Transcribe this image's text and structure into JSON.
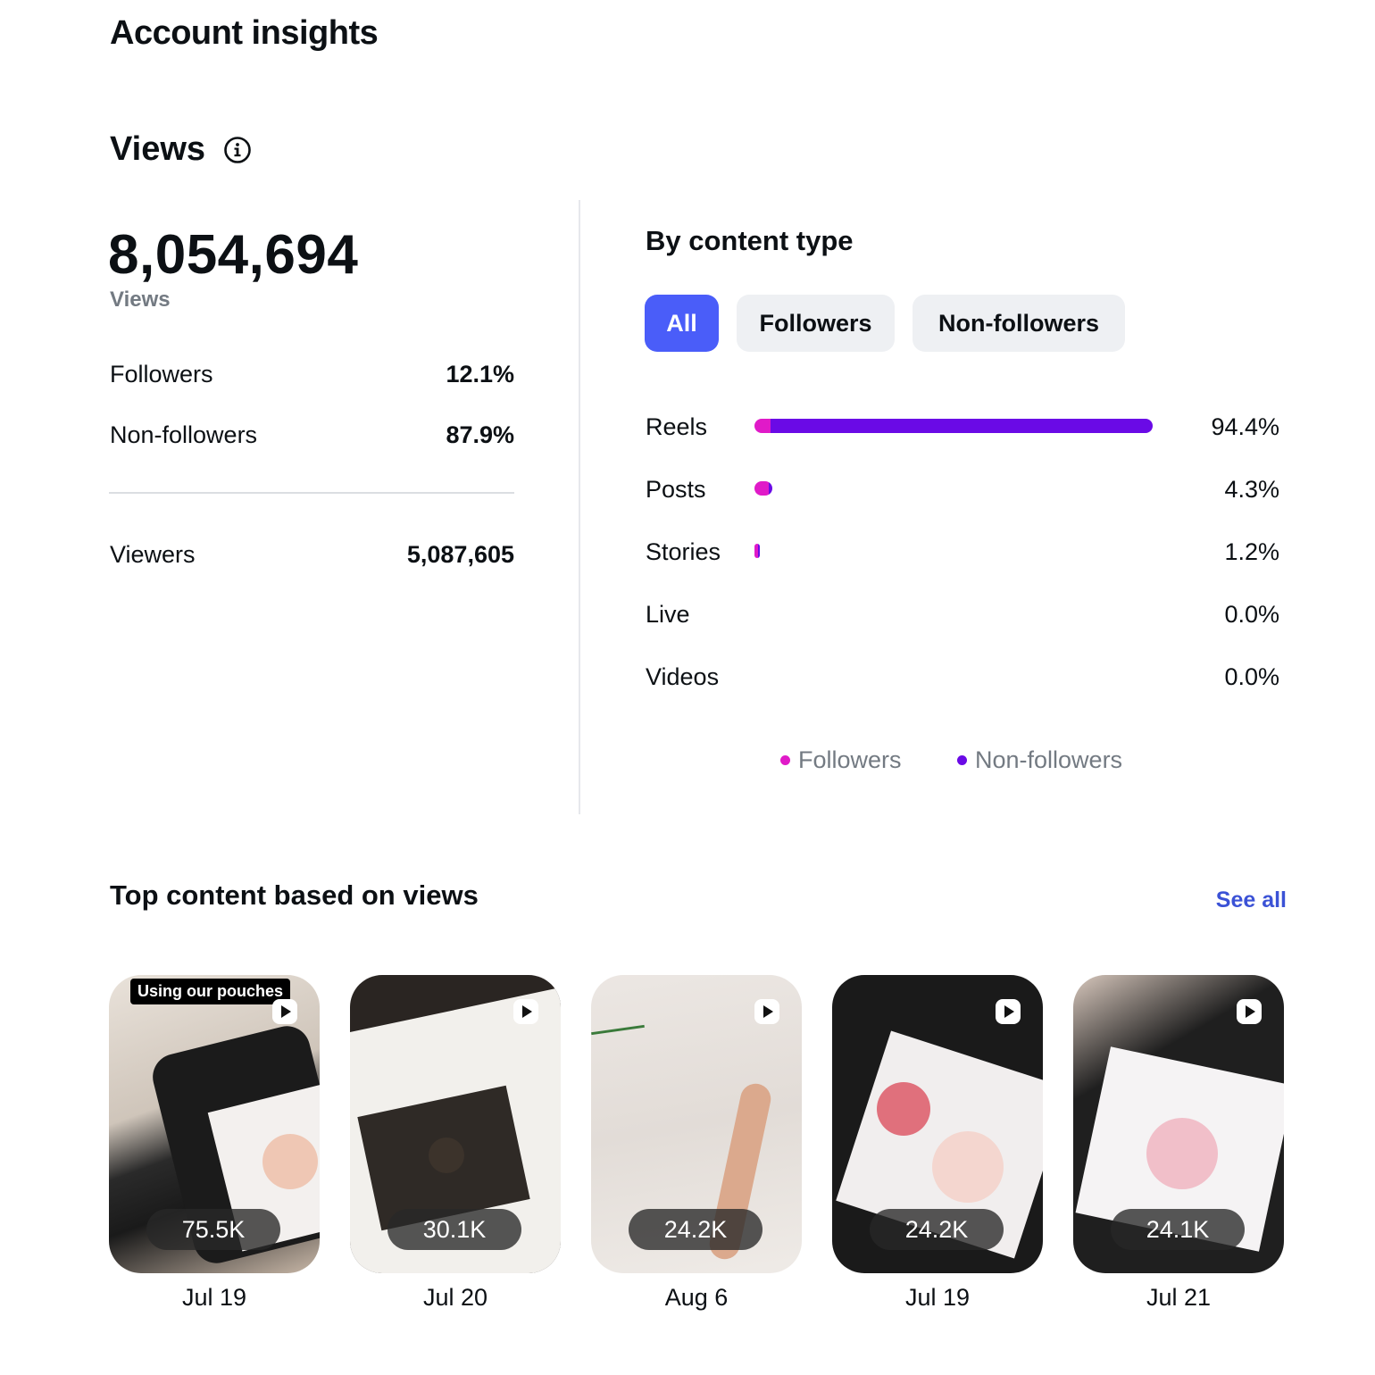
{
  "header": {
    "title": "Account insights"
  },
  "views": {
    "title": "Views",
    "total": "8,054,694",
    "total_label": "Views",
    "breakdown": [
      {
        "label": "Followers",
        "value": "12.1%"
      },
      {
        "label": "Non-followers",
        "value": "87.9%"
      }
    ],
    "viewers": {
      "label": "Viewers",
      "value": "5,087,605"
    }
  },
  "content_type": {
    "title": "By content type",
    "filters": [
      {
        "label": "All",
        "active": true
      },
      {
        "label": "Followers",
        "active": false
      },
      {
        "label": "Non-followers",
        "active": false
      }
    ],
    "rows": [
      {
        "label": "Reels",
        "value": "94.4%",
        "share": 94.4
      },
      {
        "label": "Posts",
        "value": "4.3%",
        "share": 4.3
      },
      {
        "label": "Stories",
        "value": "1.2%",
        "share": 1.2
      },
      {
        "label": "Live",
        "value": "0.0%",
        "share": 0.0
      },
      {
        "label": "Videos",
        "value": "0.0%",
        "share": 0.0
      }
    ],
    "legend": [
      {
        "label": "Followers",
        "color": "#e01ac8"
      },
      {
        "label": "Non-followers",
        "color": "#6a0ae6"
      }
    ]
  },
  "top_content": {
    "title": "Top content based on views",
    "see_all": "See all",
    "items": [
      {
        "views": "75.5K",
        "date": "Jul 19",
        "caption": "Using our pouches",
        "icon": "reel-play-icon"
      },
      {
        "views": "30.1K",
        "date": "Jul 20",
        "icon": "reel-play-icon"
      },
      {
        "views": "24.2K",
        "date": "Aug 6",
        "icon": "reel-play-icon"
      },
      {
        "views": "24.2K",
        "date": "Jul 19",
        "icon": "reel-play-icon"
      },
      {
        "views": "24.1K",
        "date": "Jul 21",
        "icon": "reel-play-icon"
      }
    ]
  }
}
